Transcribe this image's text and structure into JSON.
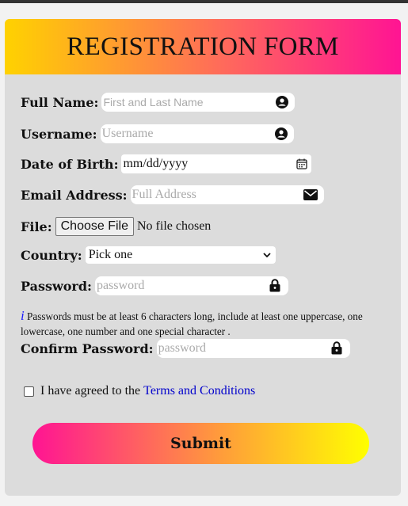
{
  "form": {
    "title": "REGISTRATION FORM",
    "full_name": {
      "label": "Full Name:",
      "placeholder": "First and Last Name",
      "icon": "user-icon"
    },
    "username": {
      "label": "Username:",
      "placeholder": "Username",
      "icon": "user-icon"
    },
    "dob": {
      "label": "Date of Birth:",
      "value": "mm/dd/yyyy",
      "icon": "calendar-icon"
    },
    "email": {
      "label": "Email Address:",
      "placeholder": "Full Address",
      "icon": "envelope-icon"
    },
    "file": {
      "label": "File:",
      "button": "Choose File",
      "status": "No file chosen"
    },
    "country": {
      "label": "Country:",
      "selected": "Pick one"
    },
    "password": {
      "label": "Password:",
      "placeholder": "password",
      "icon": "lock-icon"
    },
    "hint": {
      "icon_text": "i",
      "text": "Passwords must be at least 6 characters long, include at least one uppercase, one lowercase, one number and one special character ."
    },
    "confirm_password": {
      "label": "Confirm Password:",
      "placeholder": "password",
      "icon": "lock-icon"
    },
    "terms": {
      "text": "I have agreed to the",
      "link": "Terms and Conditions"
    },
    "submit": "Submit"
  },
  "colors": {
    "header_gradient": [
      "#ffd200",
      "#ff6a5b",
      "#ff1493"
    ],
    "submit_gradient": [
      "#ff1493",
      "#ff9a3c",
      "#ffff00"
    ],
    "card_bg": "#dcdcdc",
    "link": "#0000cc",
    "hint_icon": "#1a1aff"
  }
}
